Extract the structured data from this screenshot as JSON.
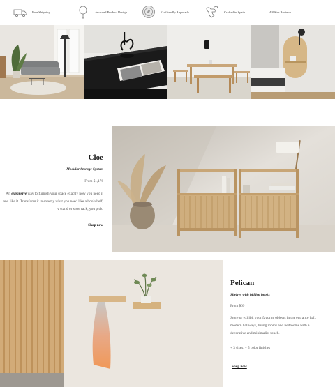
{
  "features": [
    {
      "icon": "van-icon",
      "label": "Free Shipping"
    },
    {
      "icon": "tree-icon",
      "label": "Awarded Product Design"
    },
    {
      "icon": "eco-badge-icon",
      "label": "Ecofriendly Approach"
    },
    {
      "icon": "hand-crafted-icon",
      "label": "Crafted in Spain"
    },
    {
      "icon": "stars-icon",
      "label": "4.8 Star Reviews"
    }
  ],
  "cloe": {
    "title": "Cloe",
    "subtitle": "Modular Storage System",
    "price": "From $1,176",
    "desc_em": "expansive",
    "desc_lead": "An",
    "desc_rest": "way to furnish your space exactly how you need it and like it. Transform it in exactly what you need like a bookshelf, tv stand or shoe rack, you pick.",
    "shop_label": "Shop now"
  },
  "pelican": {
    "title": "Pelican",
    "subtitle": "Shelves with hidden hooks",
    "price": "From $69",
    "desc": "Store or exhibit your favorite objects in the entrance hall, modern hallways, living rooms and bedrooms with a decorative and minimalist touch.",
    "sizes": "+ 3 sizes, + 5 color finishes",
    "shop_label": "Shop now"
  }
}
